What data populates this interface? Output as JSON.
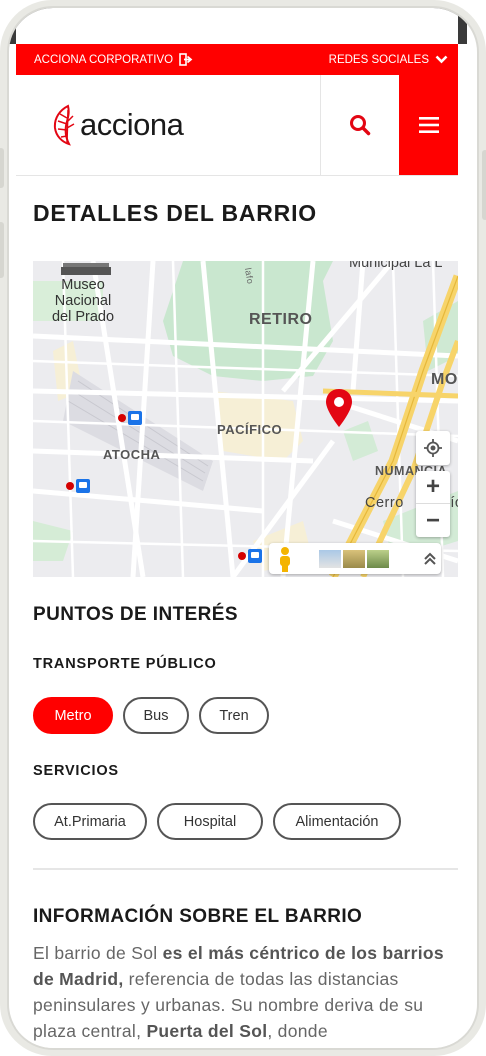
{
  "topbar": {
    "corporate_label": "ACCIONA CORPORATIVO",
    "social_label": "REDES SOCIALES"
  },
  "header": {
    "logo_text": "acciona"
  },
  "page_title": "DETALLES DEL BARRIO",
  "map": {
    "labels": {
      "museo_line1": "Museo Nacional",
      "museo_line2": "del Prado",
      "retiro": "RETIRO",
      "pacifico": "PACÍFICO",
      "atocha": "ATOCHA",
      "numancia": "NUMANCIA",
      "mo": "MO",
      "cerro": "Cerro",
      "tio": "Tío",
      "municipal": "Municipal La L",
      "street": "lafo"
    },
    "zoom_in": "+",
    "zoom_out": "−"
  },
  "points_of_interest": {
    "heading": "PUNTOS DE INTERÉS",
    "transport_heading": "TRANSPORTE PÚBLICO",
    "transport_options": [
      "Metro",
      "Bus",
      "Tren"
    ],
    "services_heading": "SERVICIOS",
    "service_options": [
      "At.Primaria",
      "Hospital",
      "Alimentación"
    ]
  },
  "info": {
    "heading": "INFORMACIÓN SOBRE EL BARRIO",
    "p_1": "El  barrio de Sol ",
    "p_2": "es el más céntrico de los barrios de Madrid,",
    "p_3": " referencia de todas las distancias peninsulares y urbanas. Su nombre deriva de su plaza central, ",
    "p_4": "Puerta del Sol",
    "p_5": ", donde"
  },
  "colors": {
    "brand_red": "#ff0000",
    "text_dark": "#1a1a1a",
    "body_gray": "#666666"
  }
}
